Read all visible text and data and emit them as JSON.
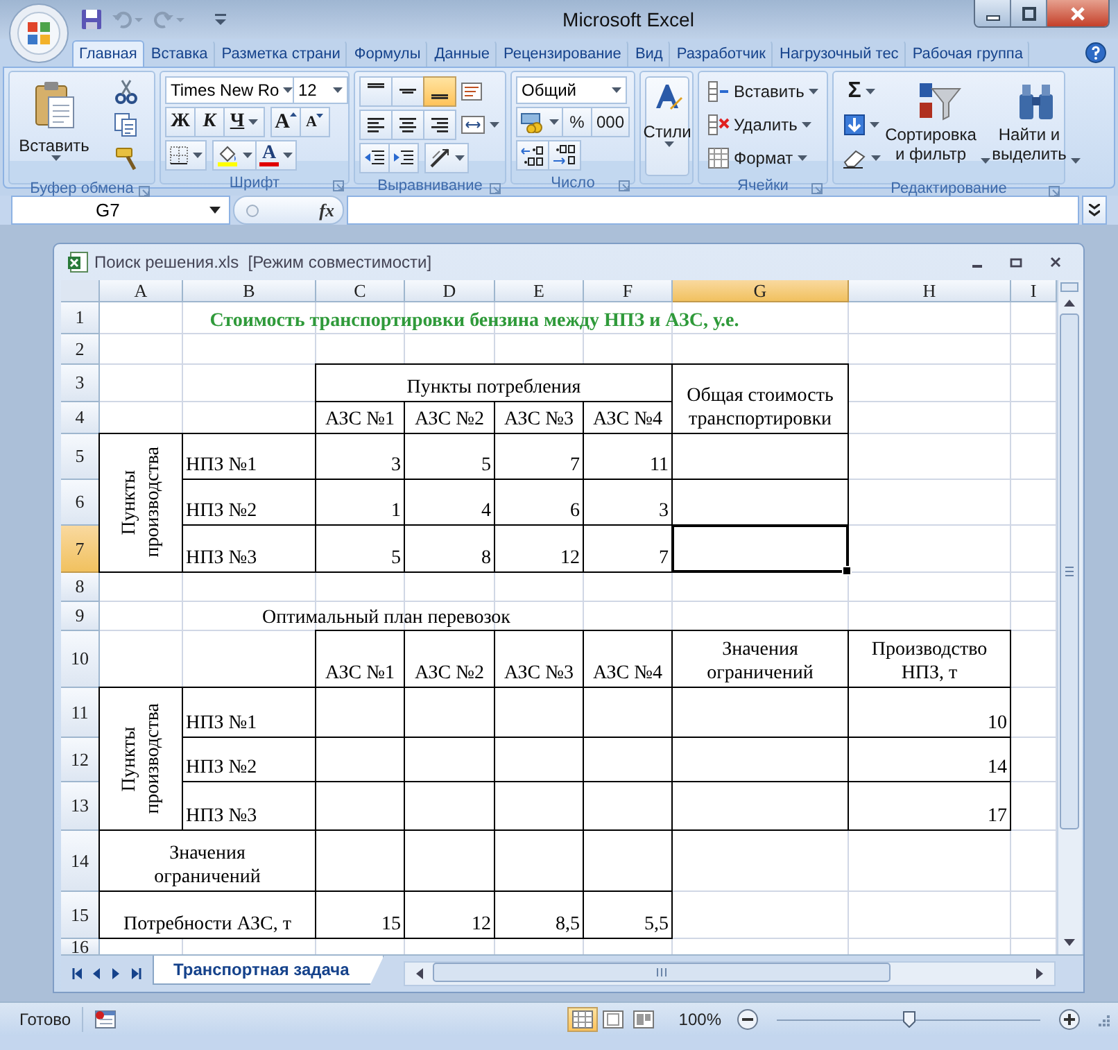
{
  "window": {
    "title": "Microsoft Excel"
  },
  "ribbon": {
    "tabs": [
      {
        "label": "Главная",
        "selected": true
      },
      {
        "label": "Вставка",
        "selected": false
      },
      {
        "label": "Разметка страни",
        "selected": false
      },
      {
        "label": "Формулы",
        "selected": false
      },
      {
        "label": "Данные",
        "selected": false
      },
      {
        "label": "Рецензирование",
        "selected": false
      },
      {
        "label": "Вид",
        "selected": false
      },
      {
        "label": "Разработчик",
        "selected": false
      },
      {
        "label": "Нагрузочный тес",
        "selected": false
      },
      {
        "label": "Рабочая группа",
        "selected": false
      }
    ],
    "clipboard": {
      "label": "Буфер обмена",
      "paste": "Вставить"
    },
    "font": {
      "label": "Шрифт",
      "name": "Times New Ro",
      "size": "12",
      "bold": "Ж",
      "italic": "К",
      "underline": "Ч",
      "grow": "A",
      "shrink": "A",
      "font_color_letter": "A"
    },
    "alignment": {
      "label": "Выравнивание",
      "valign": [
        {
          "selected": false
        },
        {
          "selected": false
        },
        {
          "selected": true
        }
      ]
    },
    "number": {
      "label": "Число",
      "format": "Общий",
      "percent": "%",
      "thousands": "000"
    },
    "styles": {
      "button": "Стили"
    },
    "cells": {
      "label": "Ячейки",
      "buttons": [
        "Вставить",
        "Удалить",
        "Формат"
      ]
    },
    "editing": {
      "label": "Редактирование",
      "sum": "Σ",
      "sort": "Сортировка и фильтр",
      "find": "Найти и выделить"
    }
  },
  "formula_bar": {
    "name_box": "G7",
    "function_label": "fx"
  },
  "workbook": {
    "title": "Поиск решения.xls  [Режим совместимости]",
    "columns": [
      {
        "label": "A",
        "selected": false
      },
      {
        "label": "B",
        "selected": false
      },
      {
        "label": "C",
        "selected": false
      },
      {
        "label": "D",
        "selected": false
      },
      {
        "label": "E",
        "selected": false
      },
      {
        "label": "F",
        "selected": false
      },
      {
        "label": "G",
        "selected": true
      },
      {
        "label": "H",
        "selected": false
      },
      {
        "label": "I",
        "selected": false
      }
    ],
    "rows": [
      {
        "label": "1",
        "selected": false
      },
      {
        "label": "2",
        "selected": false
      },
      {
        "label": "3",
        "selected": false
      },
      {
        "label": "4",
        "selected": false
      },
      {
        "label": "5",
        "selected": false
      },
      {
        "label": "6",
        "selected": false
      },
      {
        "label": "7",
        "selected": true
      },
      {
        "label": "8",
        "selected": false
      },
      {
        "label": "9",
        "selected": false
      },
      {
        "label": "10",
        "selected": false
      },
      {
        "label": "11",
        "selected": false
      },
      {
        "label": "12",
        "selected": false
      },
      {
        "label": "13",
        "selected": false
      },
      {
        "label": "14",
        "selected": false
      },
      {
        "label": "15",
        "selected": false
      },
      {
        "label": "16",
        "selected": false
      }
    ],
    "cells": [
      {
        "kind": "title",
        "text": "Стоимость транспортировки бензина между НПЗ и АЗС, у.е.",
        "selected": false
      },
      {
        "kind": "header",
        "text": "Пункты потребления",
        "selected": false
      },
      {
        "kind": "header",
        "text": "АЗС №1",
        "selected": false
      },
      {
        "kind": "header",
        "text": "АЗС №2",
        "selected": false
      },
      {
        "kind": "header",
        "text": "АЗС №3",
        "selected": false
      },
      {
        "kind": "header",
        "text": "АЗС №4",
        "selected": false
      },
      {
        "kind": "header",
        "text": "Общая стоимость транспортировки",
        "selected": false
      },
      {
        "kind": "vertical",
        "text": "Пункты\nпроизводства",
        "selected": false
      },
      {
        "kind": "label",
        "text": "НПЗ №1",
        "selected": false
      },
      {
        "kind": "number",
        "text": "3",
        "selected": false
      },
      {
        "kind": "number",
        "text": "5",
        "selected": false
      },
      {
        "kind": "number",
        "text": "7",
        "selected": false
      },
      {
        "kind": "number",
        "text": "11",
        "selected": false
      },
      {
        "kind": "blank",
        "selected": false
      },
      {
        "kind": "label",
        "text": "НПЗ №2",
        "selected": false
      },
      {
        "kind": "number",
        "text": "1",
        "selected": false
      },
      {
        "kind": "number",
        "text": "4",
        "selected": false
      },
      {
        "kind": "number",
        "text": "6",
        "selected": false
      },
      {
        "kind": "number",
        "text": "3",
        "selected": false
      },
      {
        "kind": "blank",
        "selected": false
      },
      {
        "kind": "label",
        "text": "НПЗ №3",
        "selected": false
      },
      {
        "kind": "number",
        "text": "5",
        "selected": false
      },
      {
        "kind": "number",
        "text": "8",
        "selected": false
      },
      {
        "kind": "number",
        "text": "12",
        "selected": false
      },
      {
        "kind": "number",
        "text": "7",
        "selected": false
      },
      {
        "kind": "blank",
        "selected": true
      },
      {
        "kind": "caption",
        "text": "Оптимальный план перевозок",
        "selected": false
      },
      {
        "kind": "header",
        "text": "АЗС №1",
        "selected": false
      },
      {
        "kind": "header",
        "text": "АЗС №2",
        "selected": false
      },
      {
        "kind": "header",
        "text": "АЗС №3",
        "selected": false
      },
      {
        "kind": "header",
        "text": "АЗС №4",
        "selected": false
      },
      {
        "kind": "header",
        "text": "Значения ограничений",
        "selected": false
      },
      {
        "kind": "header",
        "text": "Производство НПЗ, т",
        "selected": false
      },
      {
        "kind": "vertical",
        "text": "Пункты\nпроизводства",
        "selected": false
      },
      {
        "kind": "label",
        "text": "НПЗ №1",
        "selected": false
      },
      {
        "kind": "blank",
        "selected": false
      },
      {
        "kind": "blank",
        "selected": false
      },
      {
        "kind": "blank",
        "selected": false
      },
      {
        "kind": "blank",
        "selected": false
      },
      {
        "kind": "blank",
        "selected": false
      },
      {
        "kind": "number",
        "text": "10",
        "selected": false
      },
      {
        "kind": "label",
        "text": "НПЗ №2",
        "selected": false
      },
      {
        "kind": "blank",
        "selected": false
      },
      {
        "kind": "blank",
        "selected": false
      },
      {
        "kind": "blank",
        "selected": false
      },
      {
        "kind": "blank",
        "selected": false
      },
      {
        "kind": "blank",
        "selected": false
      },
      {
        "kind": "number",
        "text": "14",
        "selected": false
      },
      {
        "kind": "label",
        "text": "НПЗ №3",
        "selected": false
      },
      {
        "kind": "blank",
        "selected": false
      },
      {
        "kind": "blank",
        "selected": false
      },
      {
        "kind": "blank",
        "selected": false
      },
      {
        "kind": "blank",
        "selected": false
      },
      {
        "kind": "blank",
        "selected": false
      },
      {
        "kind": "number",
        "text": "17",
        "selected": false
      },
      {
        "kind": "header",
        "text": "Значения\nограничений",
        "selected": false
      },
      {
        "kind": "blank",
        "selected": false
      },
      {
        "kind": "blank",
        "selected": false
      },
      {
        "kind": "blank",
        "selected": false
      },
      {
        "kind": "blank",
        "selected": false
      },
      {
        "kind": "header",
        "text": "Потребности АЗС, т",
        "selected": false
      },
      {
        "kind": "number",
        "text": "15",
        "selected": false
      },
      {
        "kind": "number",
        "text": "12",
        "selected": false
      },
      {
        "kind": "number",
        "text": "8,5",
        "selected": false
      },
      {
        "kind": "number",
        "text": "5,5",
        "selected": false
      }
    ],
    "sheet_tabs": [
      {
        "label": "Транспортная задача",
        "selected": true
      }
    ]
  },
  "status_bar": {
    "status": "Готово",
    "views": [
      {
        "selected": true
      },
      {
        "selected": false
      },
      {
        "selected": false
      }
    ],
    "zoom": "100%",
    "zoom_slider": {
      "level": 0.5
    }
  }
}
